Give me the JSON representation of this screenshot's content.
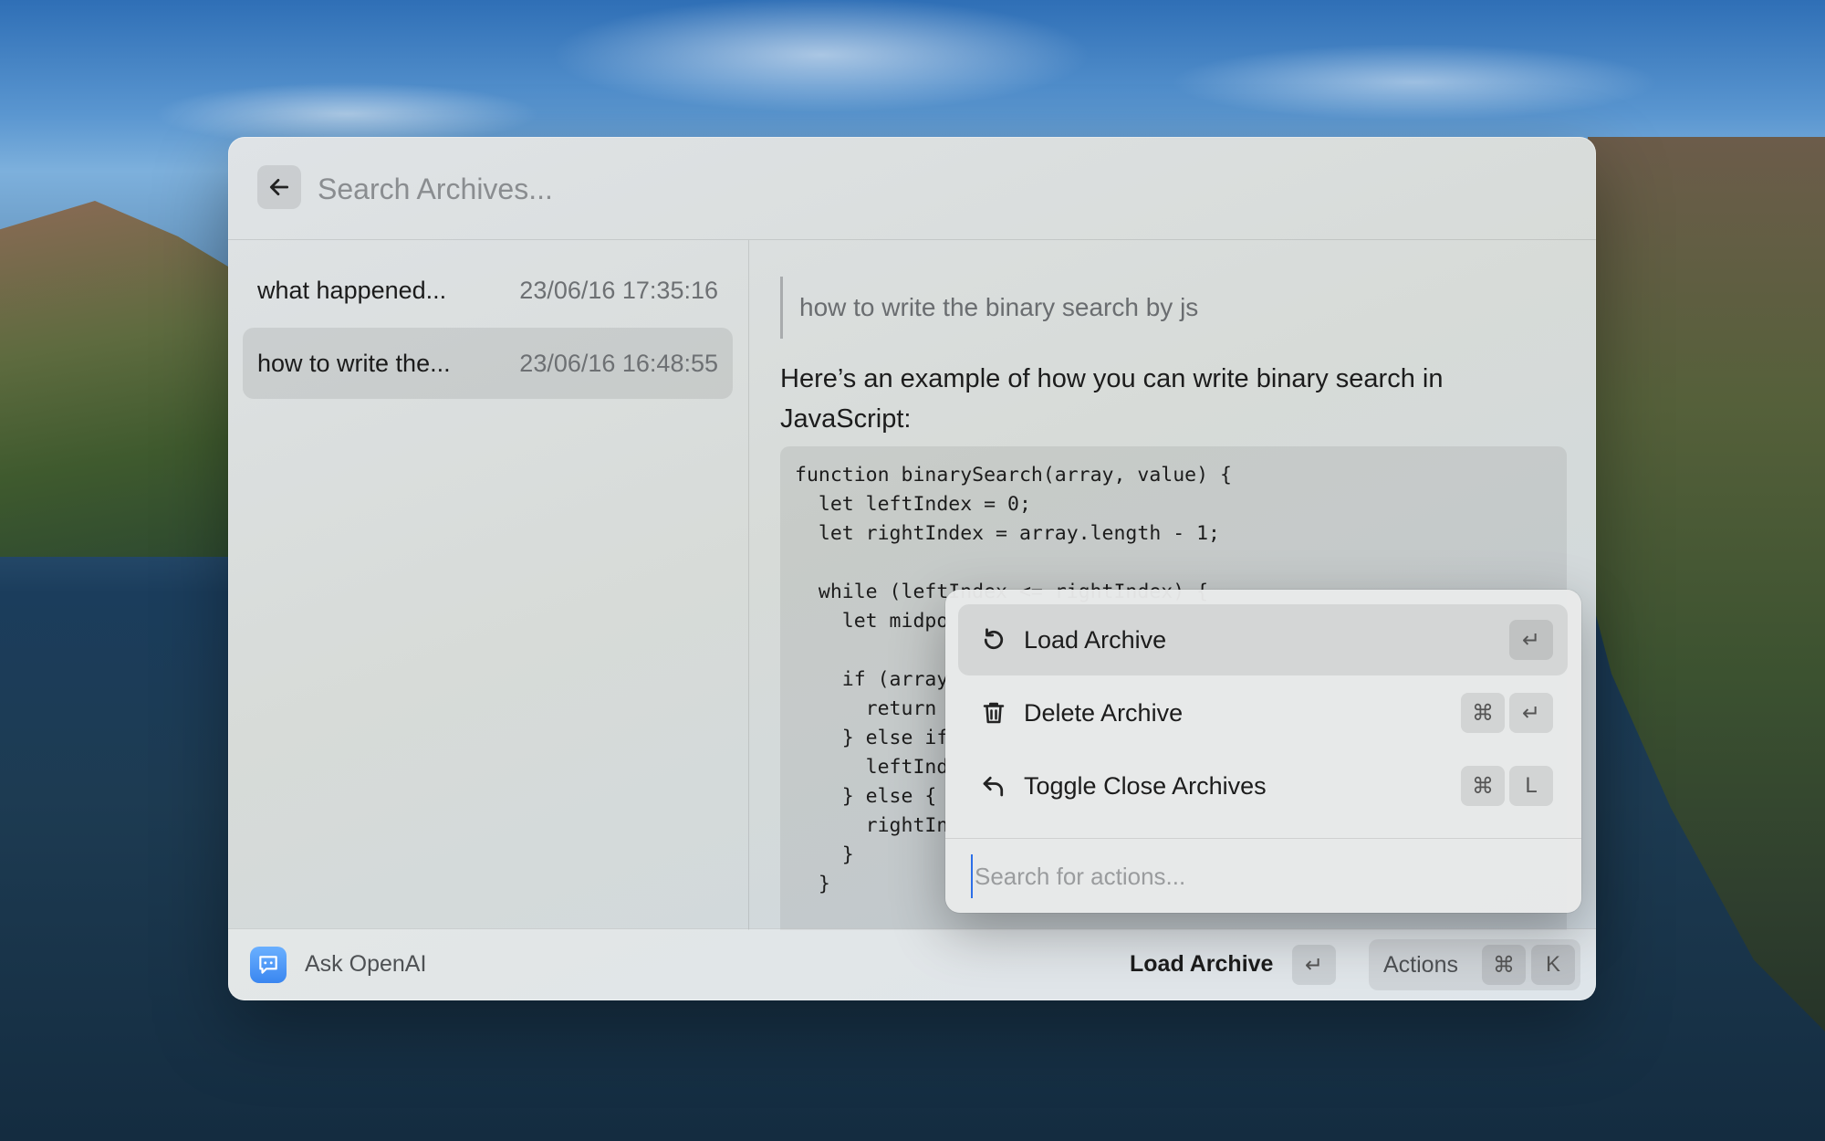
{
  "search": {
    "placeholder": "Search Archives..."
  },
  "archives": [
    {
      "title": "what happened...",
      "time": "23/06/16 17:35:16"
    },
    {
      "title": "how to write the...",
      "time": "23/06/16 16:48:55"
    }
  ],
  "detail": {
    "question": "how to write the binary search by js",
    "answer": "Here’s an example of how you can write binary search in JavaScript:",
    "code_lines": [
      "function binarySearch(array, value) {",
      "  let leftIndex = 0;",
      "  let rightIndex = array.length - 1;",
      "",
      "  while (leftIndex <= rightIndex) {",
      "    let midpo",
      "",
      "    if (array",
      "      return",
      "    } else if",
      "      leftInd",
      "    } else {",
      "      rightIn",
      "    }",
      "  }"
    ]
  },
  "footer": {
    "app_name": "Ask OpenAI",
    "primary_action": "Load Archive",
    "enter_key": "↵",
    "actions_label": "Actions",
    "cmd_key": "⌘",
    "k_key": "K"
  },
  "action_menu": {
    "items": [
      {
        "label": "Load Archive",
        "icon": "reload-icon",
        "shortcut": [
          "↵"
        ]
      },
      {
        "label": "Delete Archive",
        "icon": "trash-icon",
        "shortcut": [
          "⌘",
          "↵"
        ]
      },
      {
        "label": "Toggle Close Archives",
        "icon": "undo-arrow-icon",
        "shortcut": [
          "⌘",
          "L"
        ]
      }
    ],
    "search_placeholder": "Search for actions..."
  },
  "colors": {
    "accent": "#2c6fe8",
    "app_icon": "#4a95f5"
  }
}
